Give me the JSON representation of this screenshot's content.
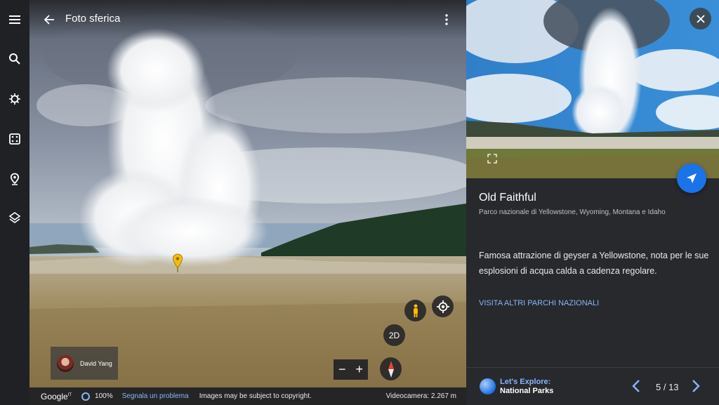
{
  "header": {
    "title": "Foto sferica"
  },
  "author": {
    "name": "David Yang"
  },
  "controls": {
    "two_d_label": "2D",
    "zoom_out": "−",
    "zoom_in": "+"
  },
  "footer": {
    "logo": "Google",
    "logo_region": "IT",
    "zoom_percent": "100%",
    "report": "Segnala un problema",
    "copyright": "Images may be subject to copyright.",
    "camera_altitude": "Videocamera: 2.267 m"
  },
  "panel": {
    "title": "Old Faithful",
    "subtitle": "Parco nazionale di Yellowstone, Wyoming, Montana e Idaho",
    "description": "Famosa attrazione di geyser a Yellowstone, nota per le sue esplosioni di acqua calda a cadenza regolare.",
    "link": "VISITA ALTRI PARCHI NAZIONALI",
    "explore_line1": "Let's Explore:",
    "explore_line2": "National Parks",
    "counter": "5 / 13"
  },
  "icons": {
    "rail": [
      "menu-icon",
      "search-icon",
      "voyager-icon",
      "dice-icon",
      "projects-icon",
      "layers-icon"
    ],
    "accent_blue": "#1a73e8",
    "link_blue": "#8ab4f8",
    "pin_yellow": "#fbbc04"
  }
}
